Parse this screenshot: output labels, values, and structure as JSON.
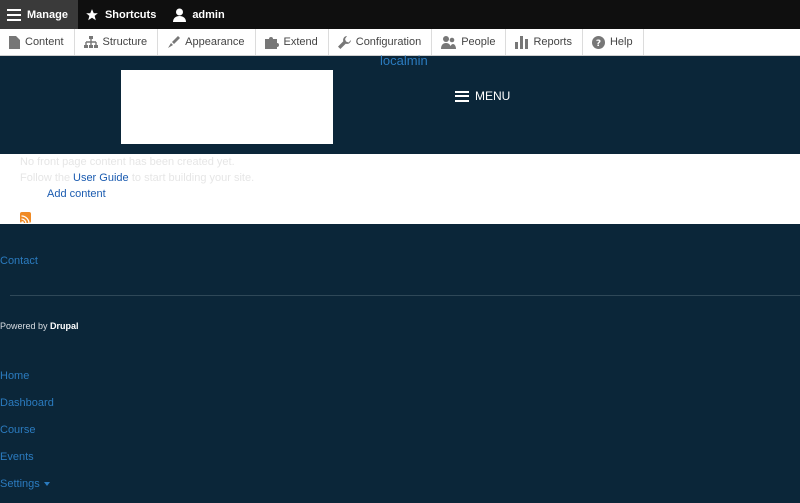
{
  "toolbar": {
    "manage": "Manage",
    "shortcuts": "Shortcuts",
    "user": "admin"
  },
  "tray": [
    {
      "label": "Content",
      "icon": "page-icon"
    },
    {
      "label": "Structure",
      "icon": "sitemap-icon"
    },
    {
      "label": "Appearance",
      "icon": "brush-icon"
    },
    {
      "label": "Extend",
      "icon": "puzzle-icon"
    },
    {
      "label": "Configuration",
      "icon": "wrench-icon"
    },
    {
      "label": "People",
      "icon": "people-icon"
    },
    {
      "label": "Reports",
      "icon": "bars-icon"
    },
    {
      "label": "Help",
      "icon": "help-icon"
    }
  ],
  "header": {
    "site_name": "localmin",
    "menu": "MENU"
  },
  "main": {
    "ghost_line1": "No front page content has been created yet.",
    "ghost_line2": "Follow the User Guide to start building your site.",
    "user_guide": "User Guide",
    "add_content": "Add content"
  },
  "footer": {
    "contact": "Contact",
    "powered_prefix": "Powered by ",
    "powered_brand": "Drupal",
    "nav": [
      "Home",
      "Dashboard",
      "Course",
      "Events",
      "Settings"
    ]
  },
  "colors": {
    "page_bg": "#0b2639",
    "link": "#2b7bbf",
    "toolbar_bg": "#0f0f0f"
  }
}
